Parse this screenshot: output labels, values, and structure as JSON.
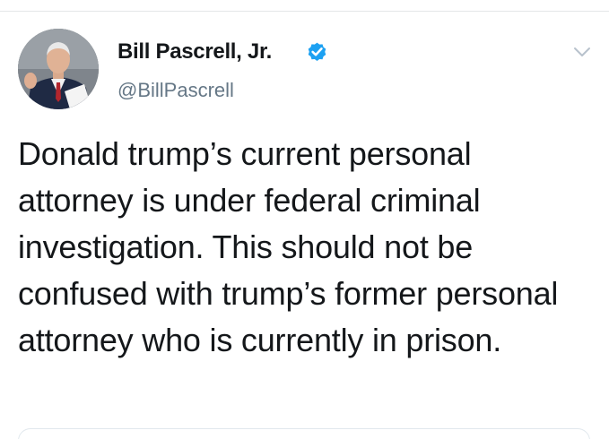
{
  "tweet": {
    "author": {
      "display_name": "Bill Pascrell, Jr.",
      "handle": "@BillPascrell",
      "verified": true
    },
    "text": "Donald trump’s current personal attorney is under federal criminal investigation. This should not be confused with trump’s former personal attorney who is currently in prison."
  },
  "icons": {
    "verified": "verified-check-icon",
    "menu": "chevron-down-icon"
  },
  "colors": {
    "verified_blue": "#1da1f2",
    "text": "#14171a",
    "secondary_text": "#657786",
    "caret": "#b8c2cc"
  }
}
